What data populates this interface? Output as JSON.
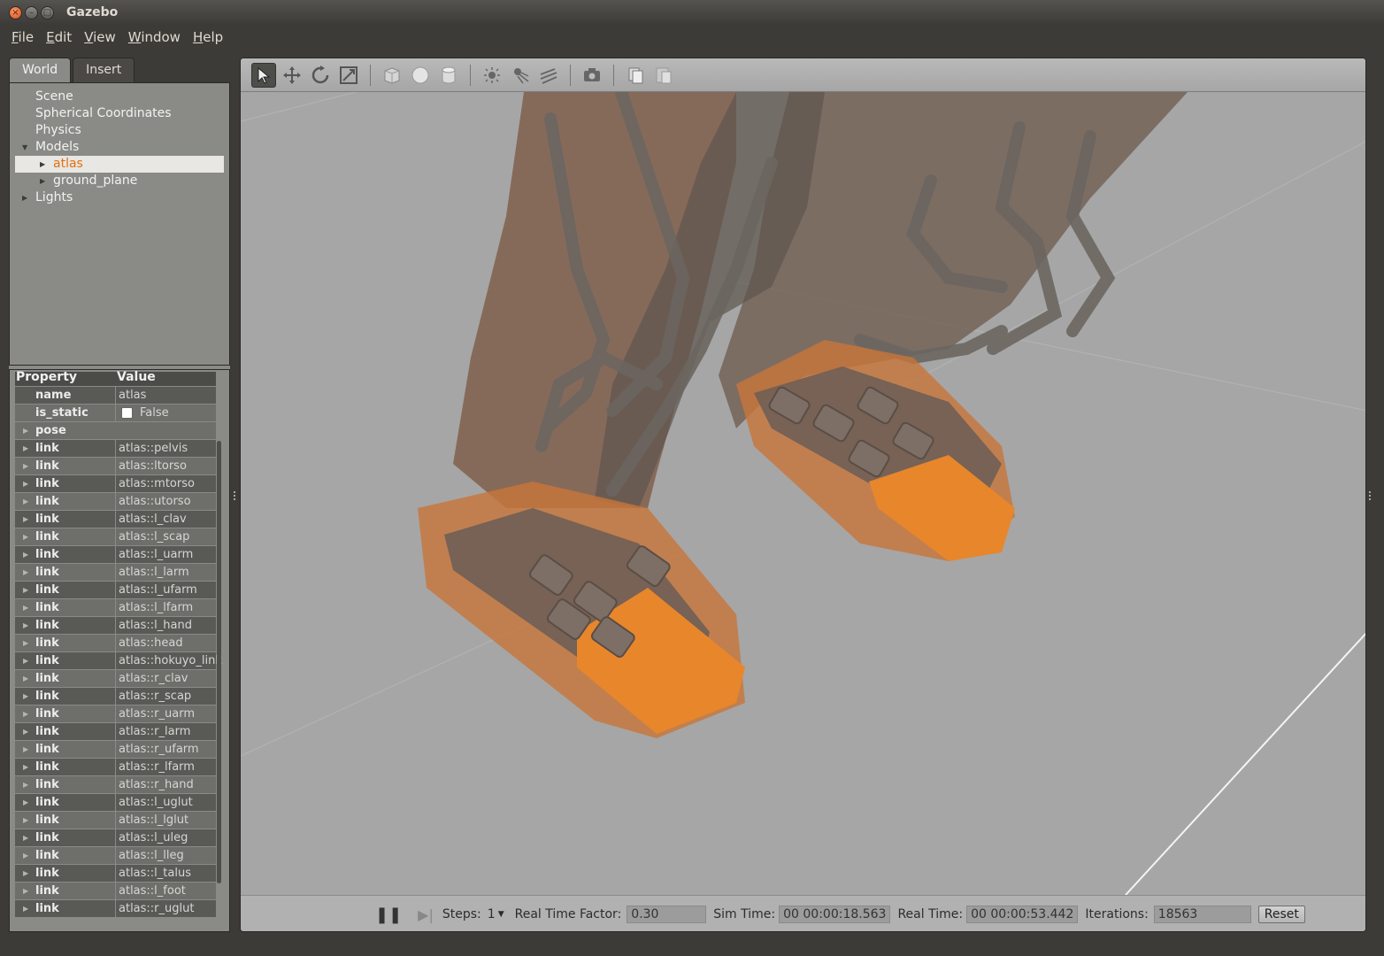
{
  "window": {
    "title": "Gazebo"
  },
  "menu": [
    "File",
    "Edit",
    "View",
    "Window",
    "Help"
  ],
  "left_tabs": {
    "world": "World",
    "insert": "Insert"
  },
  "tree": {
    "scene": "Scene",
    "spherical": "Spherical Coordinates",
    "physics": "Physics",
    "models": "Models",
    "atlas": "atlas",
    "ground_plane": "ground_plane",
    "lights": "Lights"
  },
  "props": {
    "header_property": "Property",
    "header_value": "Value",
    "name_key": "name",
    "name_val": "atlas",
    "static_key": "is_static",
    "static_val": "False",
    "pose_key": "pose",
    "links": [
      "atlas::pelvis",
      "atlas::ltorso",
      "atlas::mtorso",
      "atlas::utorso",
      "atlas::l_clav",
      "atlas::l_scap",
      "atlas::l_uarm",
      "atlas::l_larm",
      "atlas::l_ufarm",
      "atlas::l_lfarm",
      "atlas::l_hand",
      "atlas::head",
      "atlas::hokuyo_link",
      "atlas::r_clav",
      "atlas::r_scap",
      "atlas::r_uarm",
      "atlas::r_larm",
      "atlas::r_ufarm",
      "atlas::r_lfarm",
      "atlas::r_hand",
      "atlas::l_uglut",
      "atlas::l_lglut",
      "atlas::l_uleg",
      "atlas::l_lleg",
      "atlas::l_talus",
      "atlas::l_foot",
      "atlas::r_uglut"
    ],
    "link_key": "link"
  },
  "toolbar_icons": [
    "select-icon",
    "translate-icon",
    "rotate-icon",
    "scale-icon",
    "box-icon",
    "sphere-icon",
    "cylinder-icon",
    "point-light-icon",
    "spot-light-icon",
    "directional-light-icon",
    "screenshot-icon",
    "copy-icon",
    "paste-icon"
  ],
  "status": {
    "steps_label": "Steps:",
    "steps_value": "1",
    "rtf_label": "Real Time Factor:",
    "rtf_value": "0.30",
    "sim_label": "Sim Time:",
    "sim_value": "00 00:00:18.563",
    "real_label": "Real Time:",
    "real_value": "00 00:00:53.442",
    "iter_label": "Iterations:",
    "iter_value": "18563",
    "reset_label": "Reset"
  },
  "colors": {
    "accent": "#e07010",
    "selection_orange": "#e8822a"
  }
}
